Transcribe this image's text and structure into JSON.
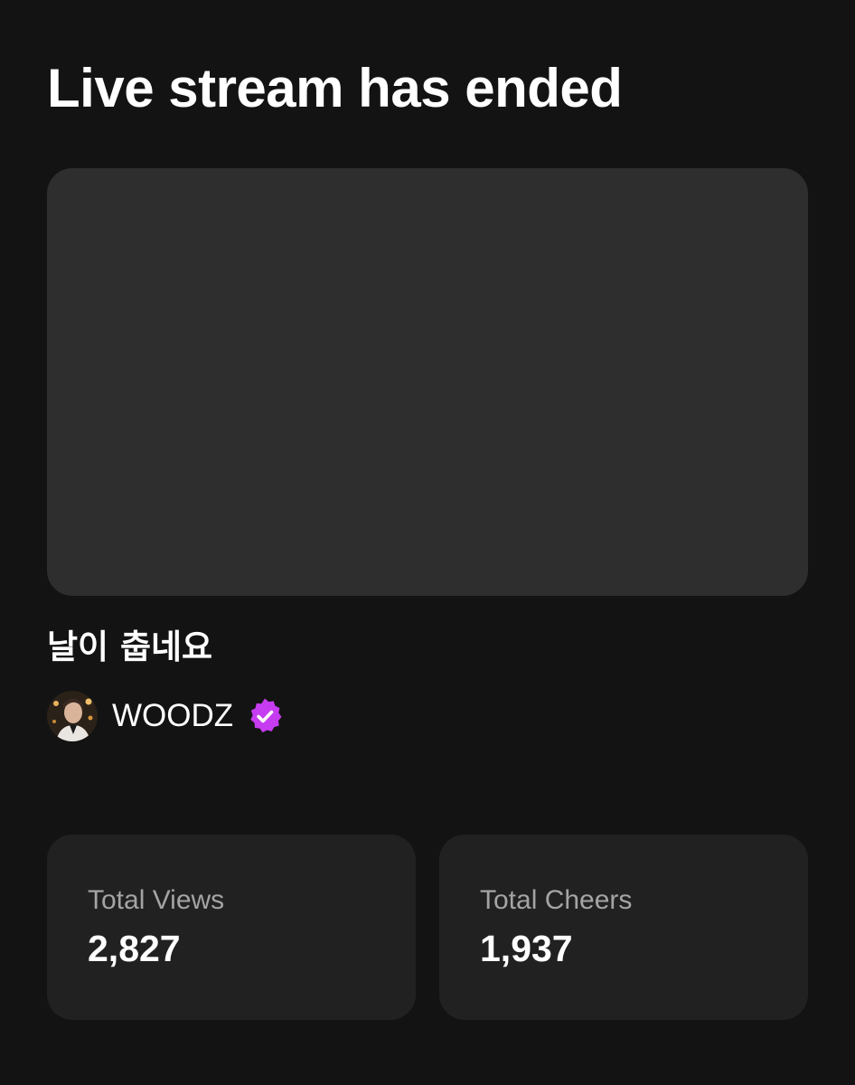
{
  "header": {
    "title": "Live stream has ended"
  },
  "stream": {
    "title": "날이 춥네요",
    "creator": {
      "name": "WOODZ",
      "verified_icon": "verified-badge-icon",
      "verified_color": "#c63cf0"
    }
  },
  "stats": {
    "views": {
      "label": "Total Views",
      "value": "2,827"
    },
    "cheers": {
      "label": "Total Cheers",
      "value": "1,937"
    }
  },
  "colors": {
    "background": "#131313",
    "thumbnail": "#2e2e2e",
    "card": "#212121",
    "label": "#a4a4a4",
    "text": "#ffffff"
  }
}
